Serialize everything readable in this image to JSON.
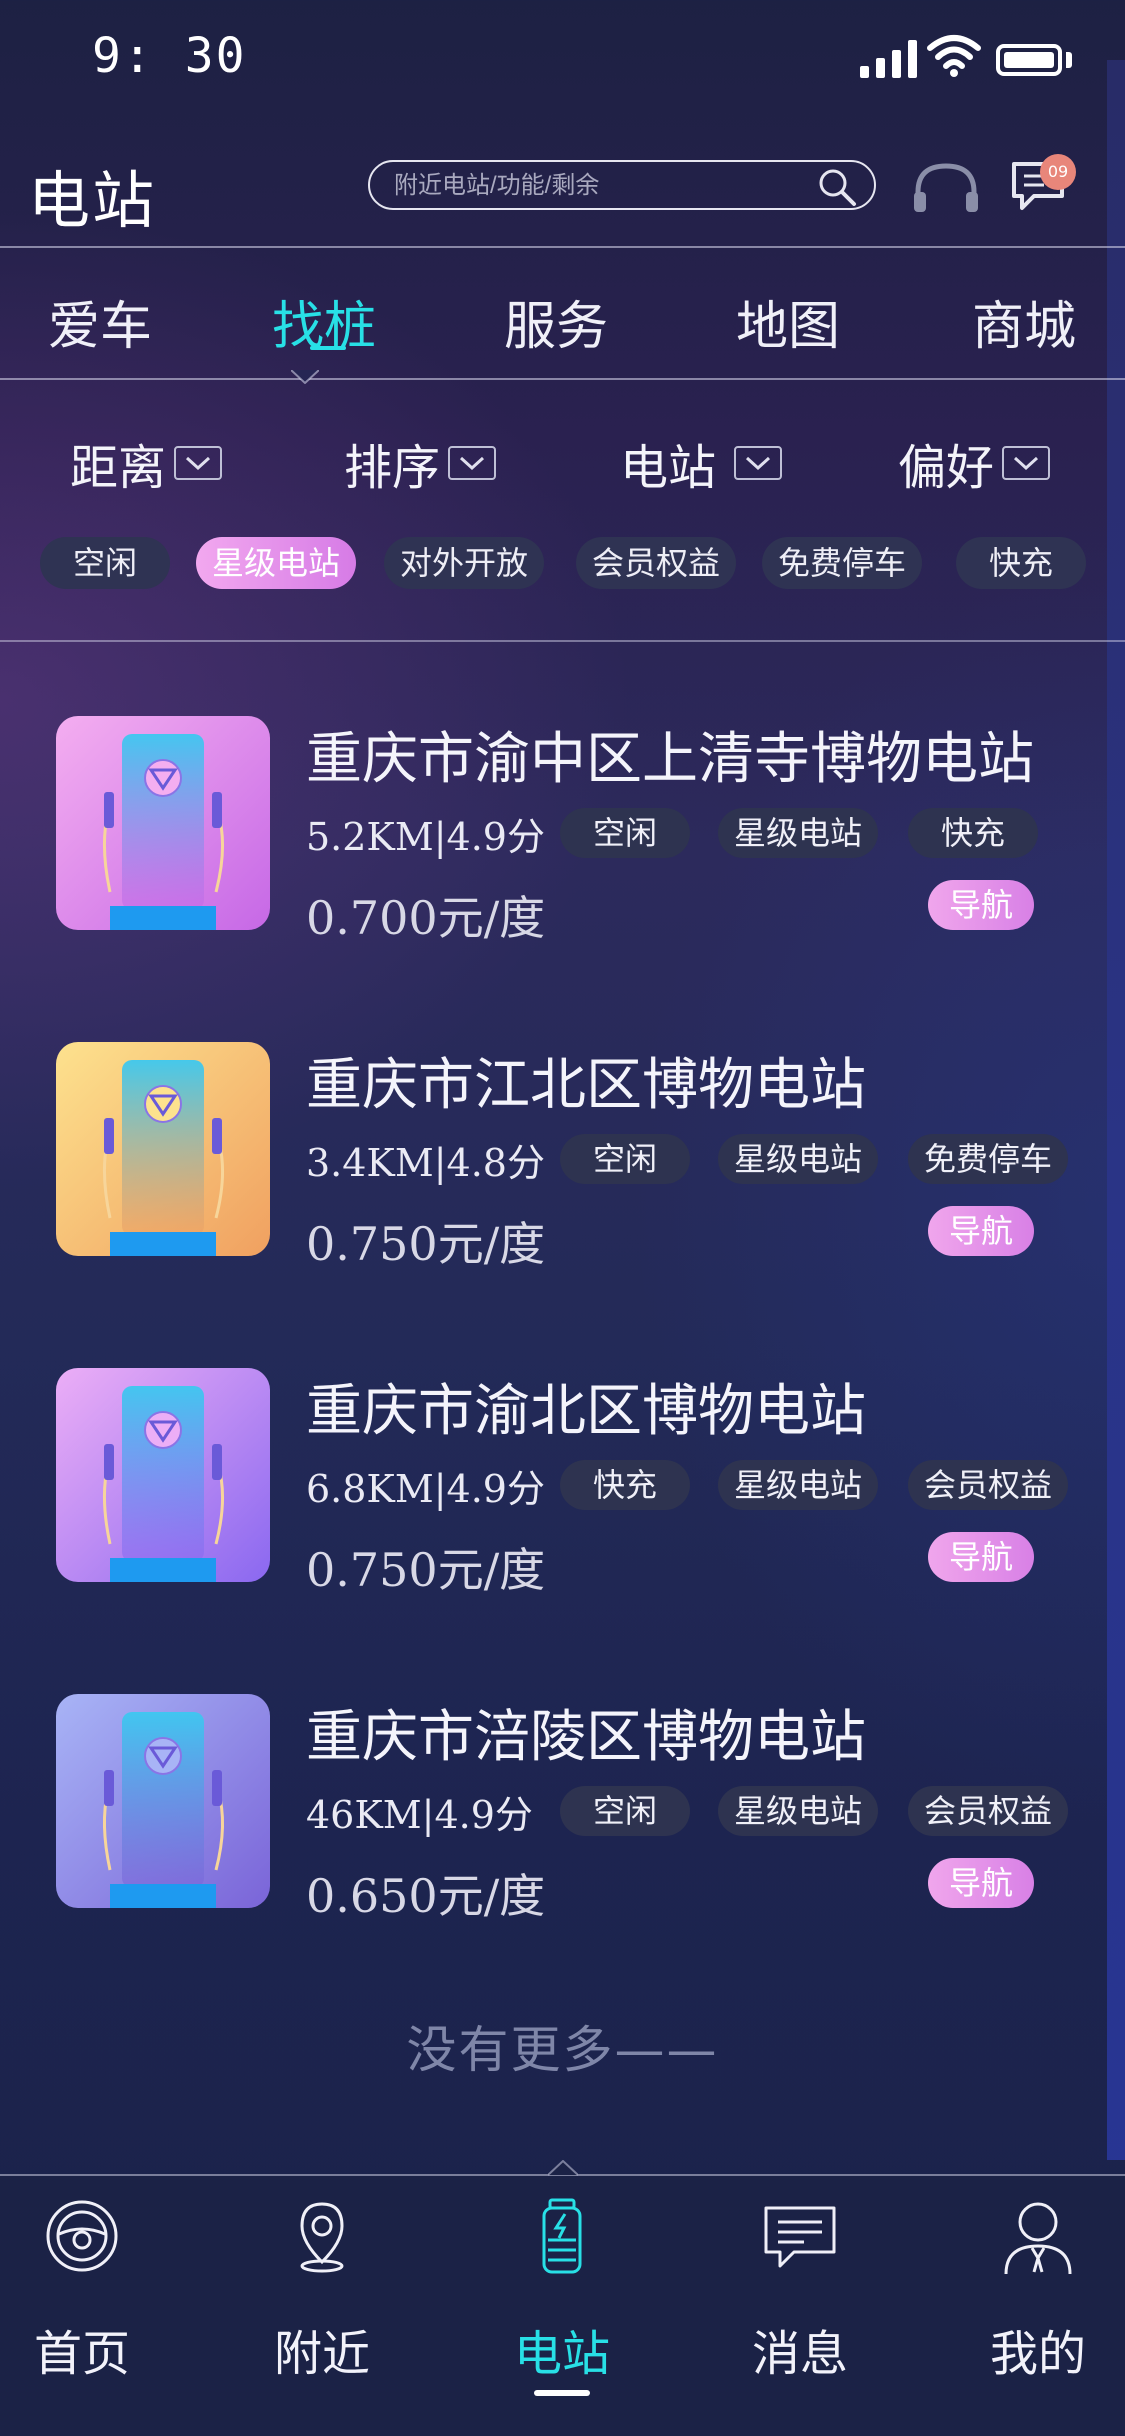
{
  "status_bar": {
    "time": "9: 30"
  },
  "header": {
    "title": "电站",
    "search_placeholder": "附近电站/功能/剩余",
    "message_badge": "09"
  },
  "tabs": [
    {
      "label": "爱车",
      "active": false
    },
    {
      "label": "找桩",
      "active": true
    },
    {
      "label": "服务",
      "active": false
    },
    {
      "label": "地图",
      "active": false
    },
    {
      "label": "商城",
      "active": false
    }
  ],
  "filters": [
    {
      "label": "距离"
    },
    {
      "label": "排序"
    },
    {
      "label": "电站"
    },
    {
      "label": "偏好"
    }
  ],
  "chips": [
    {
      "label": "空闲",
      "active": false
    },
    {
      "label": "星级电站",
      "active": true
    },
    {
      "label": "对外开放",
      "active": false
    },
    {
      "label": "会员权益",
      "active": false
    },
    {
      "label": "免费停车",
      "active": false
    },
    {
      "label": "快充",
      "active": false
    }
  ],
  "stations": [
    {
      "name": "重庆市渝中区上清寺博物电站",
      "meta": "5.2KM|4.9分",
      "tags": [
        "空闲",
        "星级电站",
        "快充"
      ],
      "price": "0.700元/度",
      "nav_label": "导航",
      "thumb_colors": [
        "#f4aef0",
        "#c668e6"
      ]
    },
    {
      "name": "重庆市江北区博物电站",
      "meta": "3.4KM|4.8分",
      "tags": [
        "空闲",
        "星级电站",
        "免费停车"
      ],
      "price": "0.750元/度",
      "nav_label": "导航",
      "thumb_colors": [
        "#fde28e",
        "#f0a060"
      ]
    },
    {
      "name": "重庆市渝北区博物电站",
      "meta": "6.8KM|4.9分",
      "tags": [
        "快充",
        "星级电站",
        "会员权益"
      ],
      "price": "0.750元/度",
      "nav_label": "导航",
      "thumb_colors": [
        "#ecaef6",
        "#8a68f0"
      ]
    },
    {
      "name": "重庆市涪陵区博物电站",
      "meta": "46KM|4.9分",
      "tags": [
        "空闲",
        "星级电站",
        "会员权益"
      ],
      "price": "0.650元/度",
      "nav_label": "导航",
      "thumb_colors": [
        "#a8b4f6",
        "#7a64d8"
      ]
    }
  ],
  "list_end_text": "没有更多——",
  "bottom_nav": [
    {
      "label": "首页",
      "icon": "steering-wheel-icon",
      "active": false
    },
    {
      "label": "附近",
      "icon": "location-pin-icon",
      "active": false
    },
    {
      "label": "电站",
      "icon": "battery-charge-icon",
      "active": true
    },
    {
      "label": "消息",
      "icon": "chat-bubble-icon",
      "active": false
    },
    {
      "label": "我的",
      "icon": "user-profile-icon",
      "active": false
    }
  ],
  "colors": {
    "accent": "#28e0e6",
    "chip_active": "#e08fea",
    "nav_button": "#e28ce9",
    "badge": "#e8867a"
  }
}
